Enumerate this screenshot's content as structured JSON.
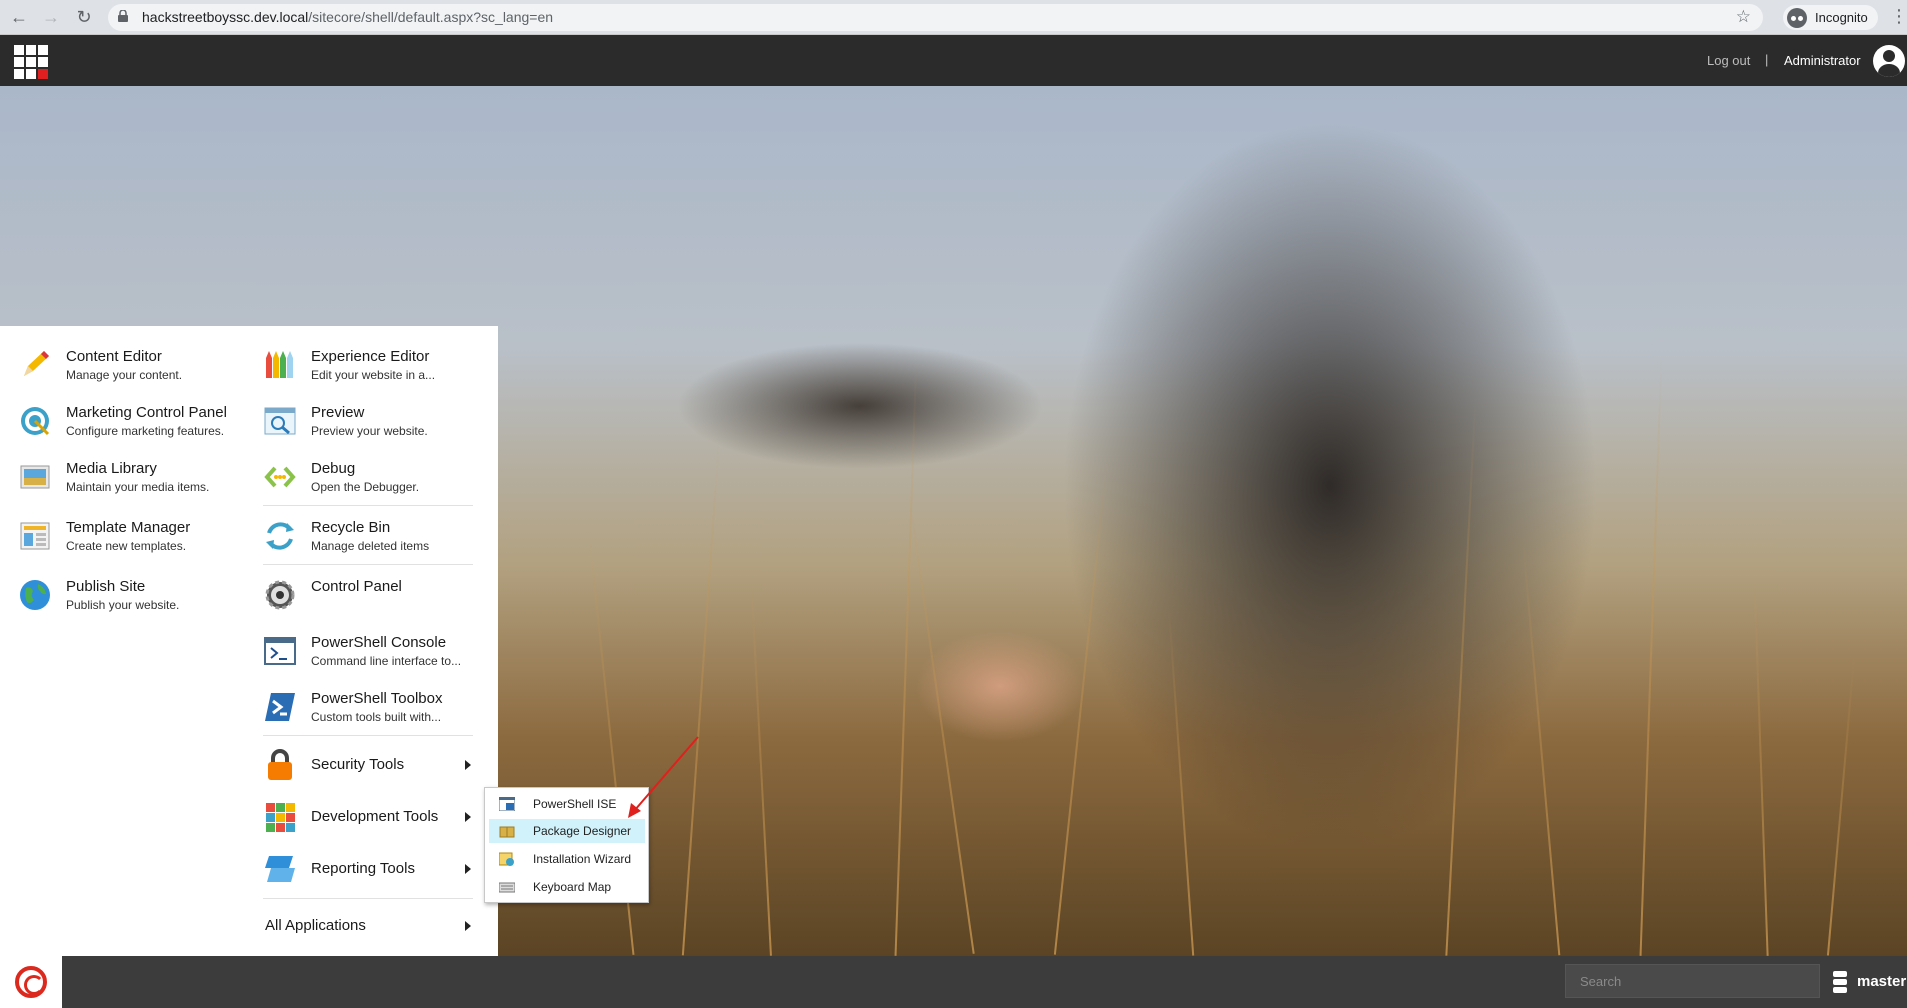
{
  "browser": {
    "url_host": "hackstreetboyssc.dev.local",
    "url_path": "/sitecore/shell/default.aspx?sc_lang=en",
    "incognito_label": "Incognito",
    "back_glyph": "←",
    "forward_glyph": "→",
    "reload_glyph": "↻",
    "star_glyph": "☆",
    "menu_glyph": "⋮"
  },
  "topbar": {
    "logout_label": "Log out",
    "divider": "|",
    "username": "Administrator"
  },
  "menu": {
    "left_items": [
      {
        "title": "Content Editor",
        "desc": "Manage your content.",
        "icon": "pencil-icon"
      },
      {
        "title": "Marketing Control Panel",
        "desc": "Configure marketing features.",
        "icon": "target-icon"
      },
      {
        "title": "Media Library",
        "desc": "Maintain your media items.",
        "icon": "media-library-icon"
      },
      {
        "title": "Template Manager",
        "desc": "Create new templates.",
        "icon": "template-icon"
      },
      {
        "title": "Publish Site",
        "desc": "Publish your website.",
        "icon": "globe-icon"
      }
    ],
    "right_items": [
      {
        "title": "Experience Editor",
        "desc": "Edit your website in a...",
        "icon": "crayons-icon"
      },
      {
        "title": "Preview",
        "desc": "Preview your website.",
        "icon": "preview-icon"
      },
      {
        "title": "Debug",
        "desc": "Open the Debugger.",
        "icon": "debug-icon"
      },
      {
        "title": "Recycle Bin",
        "desc": "Manage deleted items",
        "icon": "recycle-icon"
      },
      {
        "title": "Control Panel",
        "desc": "",
        "icon": "gear-icon"
      },
      {
        "title": "PowerShell Console",
        "desc": "Command line interface to...",
        "icon": "console-icon"
      },
      {
        "title": "PowerShell Toolbox",
        "desc": "Custom tools built with...",
        "icon": "powershell-icon"
      },
      {
        "title": "Security Tools",
        "desc": "",
        "icon": "padlock-icon"
      },
      {
        "title": "Development Tools",
        "desc": "",
        "icon": "cubes-icon"
      },
      {
        "title": "Reporting Tools",
        "desc": "",
        "icon": "reporting-icon"
      }
    ],
    "all_applications": "All Applications"
  },
  "submenu": {
    "items": [
      {
        "label": "PowerShell ISE",
        "icon": "powershell-ise-icon",
        "highlighted": false
      },
      {
        "label": "Package Designer",
        "icon": "package-icon",
        "highlighted": true
      },
      {
        "label": "Installation Wizard",
        "icon": "wizard-icon",
        "highlighted": false
      },
      {
        "label": "Keyboard Map",
        "icon": "keyboard-icon",
        "highlighted": false
      }
    ]
  },
  "bottombar": {
    "search_placeholder": "Search",
    "database": "master"
  },
  "colors": {
    "topbar": "#2b2b2b",
    "bottombar": "#3c3c3c",
    "highlight": "#d1f2fb",
    "annotation_arrow": "#e0201c",
    "brand_red": "#dc291e"
  }
}
